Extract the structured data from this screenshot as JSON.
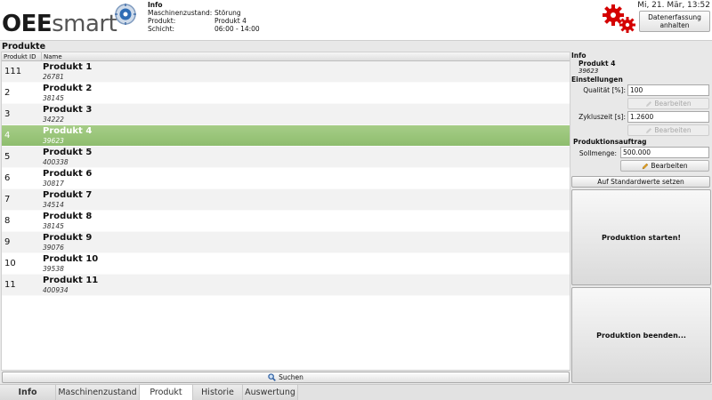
{
  "header": {
    "logo_bold": "OEE",
    "logo_light": "smart",
    "info_title": "Info",
    "info": [
      {
        "key": "Maschinenzustand:",
        "value": "Störung"
      },
      {
        "key": "Produkt:",
        "value": "Produkt 4"
      },
      {
        "key": "Schicht:",
        "value": "06:00 - 14:00"
      }
    ],
    "datetime": "Mi, 21. Mär, 13:52",
    "pause_button_line1": "Datenerfassung",
    "pause_button_line2": "anhalten",
    "status_color": "#d40000"
  },
  "products": {
    "title": "Produkte",
    "col_id": "Produkt ID",
    "col_name": "Name",
    "selected_index": 3,
    "rows": [
      {
        "id": "111",
        "name": "Produkt 1",
        "number": "26781"
      },
      {
        "id": "2",
        "name": "Produkt 2",
        "number": "38145"
      },
      {
        "id": "3",
        "name": "Produkt 3",
        "number": "34222"
      },
      {
        "id": "4",
        "name": "Produkt 4",
        "number": "39623"
      },
      {
        "id": "5",
        "name": "Produkt 5",
        "number": "400338"
      },
      {
        "id": "6",
        "name": "Produkt 6",
        "number": "30817"
      },
      {
        "id": "7",
        "name": "Produkt 7",
        "number": "34514"
      },
      {
        "id": "8",
        "name": "Produkt 8",
        "number": "38145"
      },
      {
        "id": "9",
        "name": "Produkt 9",
        "number": "39076"
      },
      {
        "id": "10",
        "name": "Produkt 10",
        "number": "39538"
      },
      {
        "id": "11",
        "name": "Produkt 11",
        "number": "400934"
      }
    ],
    "search_label": "Suchen",
    "selected_color": "#97c478"
  },
  "side": {
    "info_title": "Info",
    "product_name": "Produkt 4",
    "product_number": "39623",
    "settings_title": "Einstellungen",
    "quality_label": "Qualität [%]:",
    "quality_value": "100",
    "cycle_label": "Zykluszeit [s]:",
    "cycle_value": "1.2600",
    "edit_label": "Bearbeiten",
    "order_title": "Produktionsauftrag",
    "target_label": "Sollmenge:",
    "target_value": "500.000",
    "defaults_button": "Auf Standardwerte setzen",
    "start_button": "Produktion starten!",
    "stop_button": "Produktion beenden..."
  },
  "tabs": [
    {
      "label": "Info",
      "active": false
    },
    {
      "label": "Maschinenzustand",
      "active": false
    },
    {
      "label": "Produkt",
      "active": true
    },
    {
      "label": "Historie",
      "active": false
    },
    {
      "label": "Auswertung",
      "active": false
    }
  ]
}
